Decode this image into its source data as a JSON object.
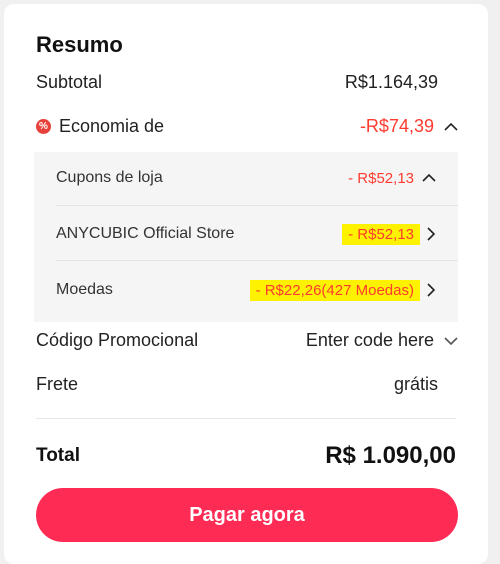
{
  "summary": {
    "title": "Resumo",
    "subtotal_label": "Subtotal",
    "subtotal_value": "R$1.164,39",
    "economia_label": "Economia de",
    "economia_value": "-R$74,39",
    "breakdown": {
      "cupons_label": "Cupons de loja",
      "cupons_value": "- R$52,13",
      "store_label": "ANYCUBIC Official Store",
      "store_value": "- R$52,13",
      "moedas_label": "Moedas",
      "moedas_value": "- R$22,26(427 Moedas)"
    },
    "promo_label": "Código Promocional",
    "promo_placeholder": "Enter code here",
    "frete_label": "Frete",
    "frete_value": "grátis",
    "total_label": "Total",
    "total_value": "R$ 1.090,00",
    "pay_button": "Pagar agora"
  },
  "colors": {
    "accent": "#fe2c55",
    "discount": "#ff3b30",
    "highlight": "#fff200"
  },
  "icons": {
    "economia": "discount-badge-icon",
    "collapse": "chevron-up-icon",
    "navigate": "chevron-right-icon",
    "dropdown": "chevron-down-icon"
  }
}
